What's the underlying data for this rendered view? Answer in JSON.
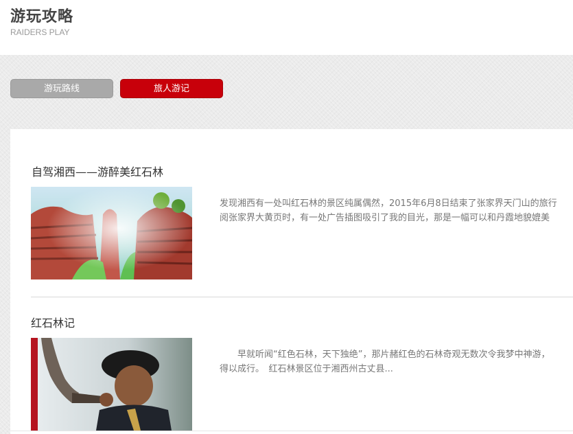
{
  "header": {
    "title": "游玩攻略",
    "subtitle": "RAIDERS PLAY"
  },
  "tabs": [
    {
      "label": "游玩路线",
      "active": false,
      "color": "#a9a9a9"
    },
    {
      "label": "旅人游记",
      "active": true,
      "color": "#c8000a"
    }
  ],
  "articles": [
    {
      "title": "自驾湘西——游醉美红石林",
      "image": "red-stone-forest-valley",
      "line1": "发现湘西有一处叫红石林的景区纯属偶然，2015年6月8日结束了张家界天门山的旅行",
      "line2": "阅张家界大黄页时，有一处广告插图吸引了我的目光，那是一幅可以和丹霞地貌媲美"
    },
    {
      "title": "红石林记",
      "image": "man-blowing-horn",
      "line1": "　　早就听闻“红色石林，天下独绝”，那片赭红色的石林奇观无数次令我梦中神游，",
      "line2": "得以成行。　红石林景区位于湘西州古丈县..."
    }
  ]
}
